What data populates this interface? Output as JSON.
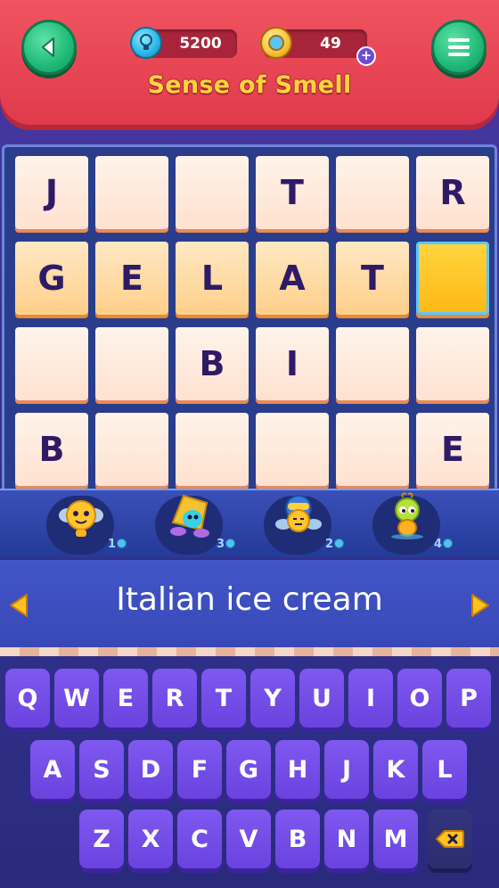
{
  "header": {
    "title": "Sense of Smell",
    "hints": "5200",
    "coins": "49",
    "plus": "+",
    "back_icon": "back-arrow-icon",
    "menu_icon": "hamburger-menu-icon",
    "colors": {
      "header": "#e8404f",
      "title": "#ffd43a",
      "button": "#1fb877"
    }
  },
  "grid": {
    "rows": [
      [
        "J",
        "",
        "",
        "T",
        "",
        "R"
      ],
      [
        "G",
        "E",
        "L",
        "A",
        "T",
        ""
      ],
      [
        "",
        "",
        "B",
        "I",
        "",
        ""
      ],
      [
        "B",
        "",
        "",
        "",
        "",
        "E"
      ]
    ],
    "active_row": 1,
    "cursor": [
      1,
      5
    ]
  },
  "helpers": [
    {
      "icon": "yellow-bee-helper-icon",
      "cost": "1"
    },
    {
      "icon": "hooded-bee-helper-icon",
      "cost": "3"
    },
    {
      "icon": "helmet-bee-helper-icon",
      "cost": "2"
    },
    {
      "icon": "green-bug-helper-icon",
      "cost": "4"
    }
  ],
  "clue": {
    "text": "Italian ice cream",
    "prev_icon": "triangle-left-icon",
    "next_icon": "triangle-right-icon"
  },
  "keyboard": {
    "row1": [
      "Q",
      "W",
      "E",
      "R",
      "T",
      "Y",
      "U",
      "I",
      "O",
      "P"
    ],
    "row2": [
      "A",
      "S",
      "D",
      "F",
      "G",
      "H",
      "J",
      "K",
      "L"
    ],
    "row3": [
      "Z",
      "X",
      "C",
      "V",
      "B",
      "N",
      "M"
    ],
    "delete_icon": "backspace-icon"
  }
}
